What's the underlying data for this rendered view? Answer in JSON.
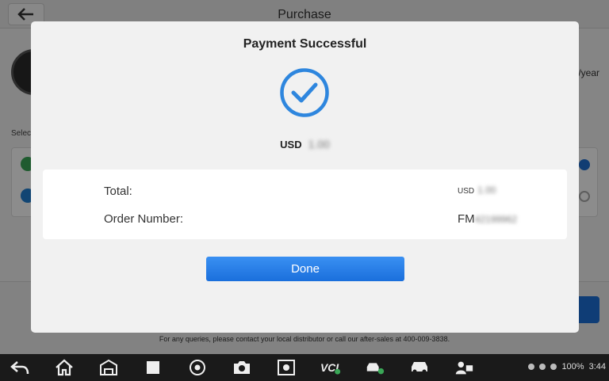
{
  "app": {
    "title": "Purchase",
    "price_suffix": "/year",
    "select_label": "Selec",
    "footer_text": "For any queries, please contact your local distributor or call our after-sales at 400-009-3838."
  },
  "modal": {
    "title": "Payment Successful",
    "amount_currency": "USD",
    "amount_value": "1.00",
    "total_label": "Total:",
    "total_currency": "USD",
    "total_value": "1.00",
    "order_label": "Order Number:",
    "order_prefix": "FM",
    "order_rest": "42199962",
    "done_label": "Done"
  },
  "status_bar": {
    "battery": "100%",
    "time": "3:44"
  },
  "colors": {
    "accent": "#2e86de",
    "button": "#1a6fdc"
  },
  "icons": [
    "back-icon",
    "home-icon",
    "shop-icon",
    "recent-apps-icon",
    "chrome-icon",
    "camera-icon",
    "brightness-icon",
    "vci-icon",
    "vehicle-connect-icon",
    "car-icon",
    "remote-support-icon"
  ]
}
